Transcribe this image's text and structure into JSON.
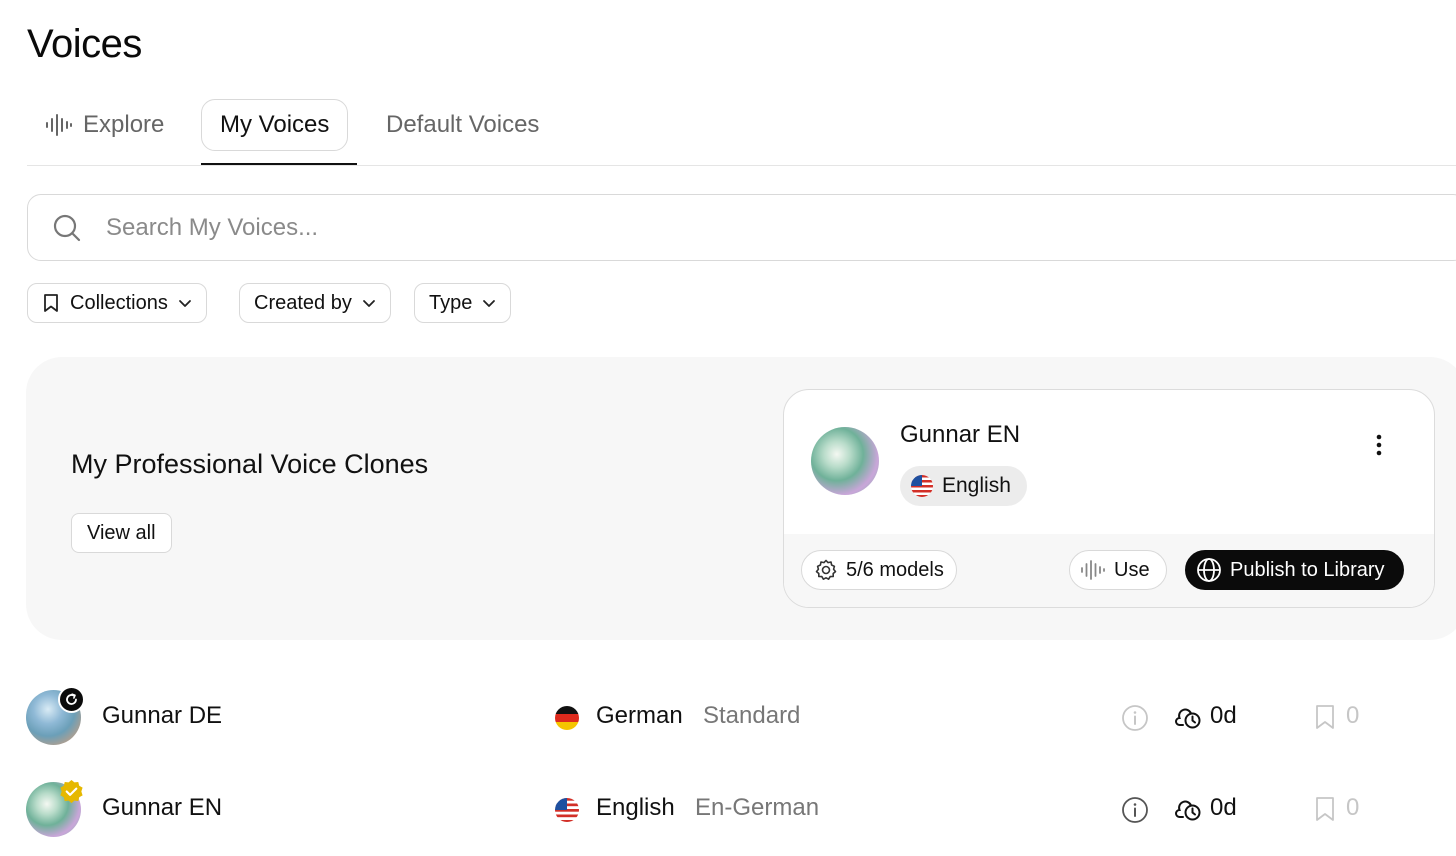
{
  "page": {
    "title": "Voices"
  },
  "tabs": [
    {
      "label": "Explore",
      "icon": "waveform-icon",
      "active": false
    },
    {
      "label": "My Voices",
      "active": true
    },
    {
      "label": "Default Voices",
      "active": false
    }
  ],
  "search": {
    "placeholder": "Search My Voices...",
    "value": ""
  },
  "filters": [
    {
      "label": "Collections",
      "icon": "bookmark-icon"
    },
    {
      "label": "Created by"
    },
    {
      "label": "Type"
    }
  ],
  "pvc": {
    "title": "My Professional Voice Clones",
    "view_all": "View all",
    "card": {
      "name": "Gunnar EN",
      "language": "English",
      "models": "5/6 models",
      "use": "Use",
      "publish": "Publish to Library"
    }
  },
  "voices": [
    {
      "name": "Gunnar DE",
      "language": "German",
      "type": "Standard",
      "days": "0d",
      "saves": "0",
      "badge": "refresh-badge-icon"
    },
    {
      "name": "Gunnar EN",
      "language": "English",
      "type": "En-German",
      "days": "0d",
      "saves": "0",
      "badge": "verified-badge-icon"
    }
  ],
  "colors": {
    "accent": "#0b0b0b",
    "panel": "#f7f7f7",
    "border": "#d9d9d9",
    "muted": "#777777",
    "verified": "#e6b800"
  }
}
